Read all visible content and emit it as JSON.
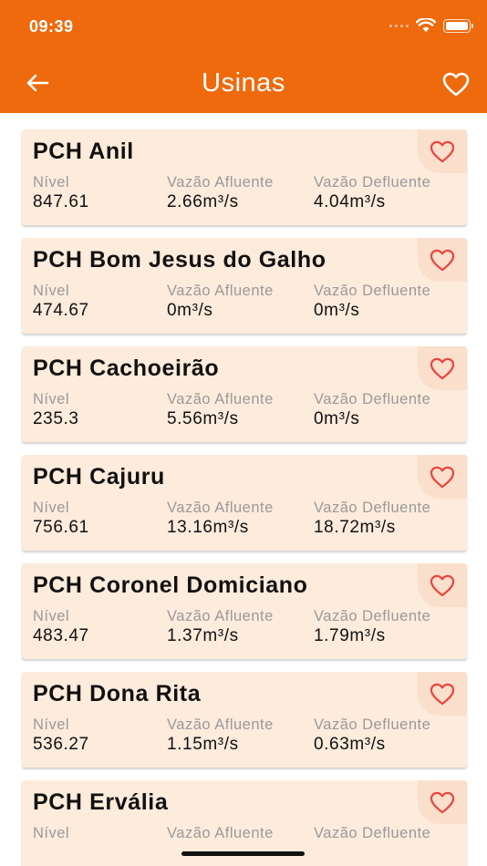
{
  "status_bar": {
    "time": "09:39"
  },
  "header": {
    "title": "Usinas"
  },
  "colors": {
    "accent": "#EE6A0D",
    "card_bg": "#FDEBDC",
    "heart": "#E8473F"
  },
  "icons": {
    "back": "arrow-left-icon",
    "favorites": "heart-outline-icon"
  },
  "cards": [
    {
      "name": "PCH Anil",
      "labels": [
        "Nível",
        "Vazão Afluente",
        "Vazão Defluente"
      ],
      "nivel": "847.61",
      "afluente": "2.66m³/s",
      "defluente": "4.04m³/s"
    },
    {
      "name": "PCH Bom Jesus do Galho",
      "labels": [
        "Nível",
        "Vazão Afluente",
        "Vazão Defluente"
      ],
      "nivel": "474.67",
      "afluente": "0m³/s",
      "defluente": "0m³/s"
    },
    {
      "name": "PCH Cachoeirão",
      "labels": [
        "Nível",
        "Vazão Afluente",
        "Vazão Defluente"
      ],
      "nivel": "235.3",
      "afluente": "5.56m³/s",
      "defluente": "0m³/s"
    },
    {
      "name": "PCH Cajuru",
      "labels": [
        "Nível",
        "Vazão Afluente",
        "Vazão Defluente"
      ],
      "nivel": "756.61",
      "afluente": "13.16m³/s",
      "defluente": "18.72m³/s"
    },
    {
      "name": "PCH Coronel Domiciano",
      "labels": [
        "Nível",
        "Vazão Afluente",
        "Vazão Defluente"
      ],
      "nivel": "483.47",
      "afluente": "1.37m³/s",
      "defluente": "1.79m³/s"
    },
    {
      "name": "PCH Dona Rita",
      "labels": [
        "Nível",
        "Vazão Afluente",
        "Vazão Defluente"
      ],
      "nivel": "536.27",
      "afluente": "1.15m³/s",
      "defluente": "0.63m³/s"
    },
    {
      "name": "PCH Ervália",
      "labels": [
        "Nível",
        "Vazão Afluente",
        "Vazão Defluente"
      ],
      "nivel": "",
      "afluente": "",
      "defluente": ""
    }
  ]
}
